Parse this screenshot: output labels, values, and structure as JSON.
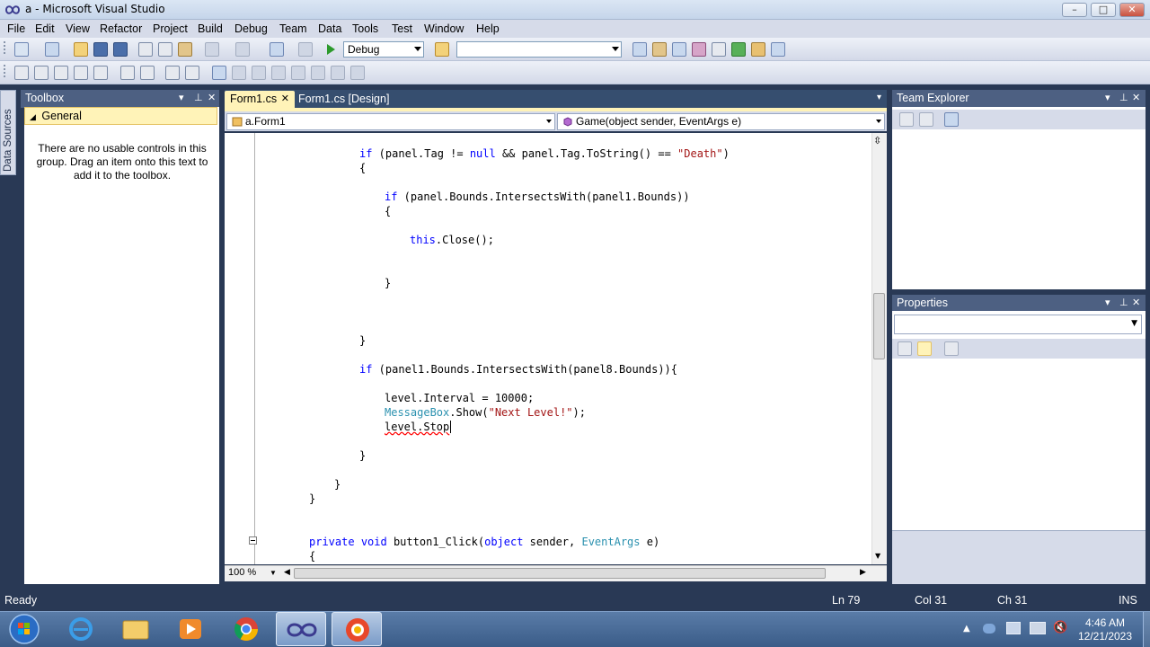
{
  "window": {
    "title": "a - Microsoft Visual Studio",
    "controls": {
      "minimize": "–",
      "maximize": "□",
      "close": "✕"
    }
  },
  "menu": [
    "File",
    "Edit",
    "View",
    "Refactor",
    "Project",
    "Build",
    "Debug",
    "Team",
    "Data",
    "Tools",
    "Test",
    "Window",
    "Help"
  ],
  "toolbar": {
    "configuration": "Debug",
    "platform": "",
    "icons": [
      "new-project-icon",
      "add-item-icon",
      "open-file-icon",
      "save-icon",
      "save-all-icon",
      "cut-icon",
      "copy-icon",
      "paste-icon",
      "undo-icon",
      "redo-icon",
      "navigate-back-icon",
      "start-debugging-icon",
      "find-icon",
      "solution-explorer-icon",
      "properties-icon",
      "object-browser-icon",
      "toolbox-icon",
      "start-page-icon",
      "command-window-icon"
    ]
  },
  "toolbox": {
    "title": "Toolbox",
    "group": "General",
    "message": "There are no usable controls in this group. Drag an item onto this text to add it to the toolbox."
  },
  "side_tab": {
    "label": "Data Sources"
  },
  "doc_tabs": {
    "active": "Form1.cs",
    "inactive": "Form1.cs [Design]"
  },
  "nav": {
    "class_combo": "a.Form1",
    "member_combo": "Game(object sender, EventArgs e)"
  },
  "code": {
    "l1_kw": "if",
    "l1_a": " (panel.Tag != ",
    "l1_null": "null",
    "l1_b": " && panel.Tag.ToString() == ",
    "l1_str": "\"Death\"",
    "l1_c": ")",
    "brace_open": "{",
    "brace_close": "}",
    "l3_kw": "if",
    "l3_a": " (panel.Bounds.IntersectsWith(panel1.Bounds))",
    "l5_kw": "this",
    "l5_a": ".Close();",
    "l8_kw": "if",
    "l8_a": " (panel1.Bounds.IntersectsWith(panel8.Bounds)){",
    "l9": "level.Interval = 10000;",
    "l10_type": "MessageBox",
    "l10_a": ".Show(",
    "l10_str": "\"Next Level!\"",
    "l10_b": ");",
    "l11": "level.Stop",
    "l14_kw1": "private",
    "l14_kw2": "void",
    "l14_a": " button1_Click(",
    "l14_kw3": "object",
    "l14_b": " sender, ",
    "l14_type": "EventArgs",
    "l14_c": " e)"
  },
  "editor": {
    "zoom": "100 %"
  },
  "team_explorer": {
    "title": "Team Explorer"
  },
  "properties": {
    "title": "Properties"
  },
  "status": {
    "ready": "Ready",
    "ln": "Ln 79",
    "col": "Col 31",
    "ch": "Ch 31",
    "mode": "INS"
  },
  "taskbar": {
    "apps": [
      "start-orb-icon",
      "internet-explorer-icon",
      "file-explorer-icon",
      "media-player-icon",
      "chrome-icon",
      "visual-studio-icon",
      "app-icon"
    ],
    "time": "4:46 AM",
    "date": "12/21/2023"
  },
  "colors": {
    "chrome": "#293955",
    "panel_header": "#4d6082",
    "active_tab": "#fff3b8",
    "keyword": "#0000ff",
    "string": "#a31515",
    "type": "#2b91af"
  }
}
